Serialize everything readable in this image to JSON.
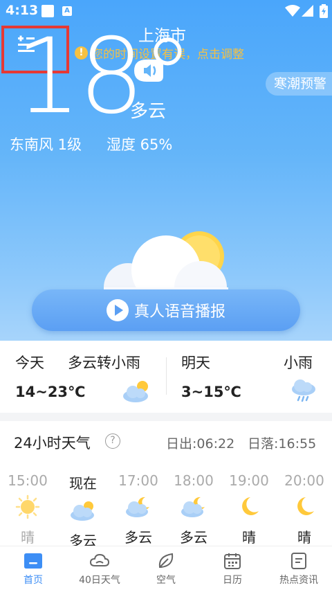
{
  "status_bar": {
    "time": "4:13",
    "app_badge": "A"
  },
  "header": {
    "city": "上海市",
    "warning": "您的时间设置有误，点击调整"
  },
  "current": {
    "temperature": "18°",
    "condition": "多云",
    "wind": "东南风 1级",
    "humidity": "湿度 65%",
    "alert": "寒潮预警"
  },
  "voice": {
    "label": "真人语音播报"
  },
  "forecast": [
    {
      "day": "今天",
      "condition": "多云转小雨",
      "range": "14~23℃",
      "icon": "cloudy-sun-icon"
    },
    {
      "day": "明天",
      "condition": "小雨",
      "range": "3~15℃",
      "icon": "light-rain-icon"
    }
  ],
  "hourly": {
    "title": "24小时天气",
    "sunrise": "日出:06:22",
    "sunset": "日落:16:55",
    "items": [
      {
        "time": "15:00",
        "icon": "sun-icon",
        "condition": "晴",
        "past": true
      },
      {
        "time": "现在",
        "icon": "cloudy-sun-icon",
        "condition": "多云",
        "past": false
      },
      {
        "time": "17:00",
        "icon": "cloudy-moon-icon",
        "condition": "多云",
        "past": false
      },
      {
        "time": "18:00",
        "icon": "cloudy-moon-icon",
        "condition": "多云",
        "past": false
      },
      {
        "time": "19:00",
        "icon": "moon-icon",
        "condition": "晴",
        "past": false
      },
      {
        "time": "20:00",
        "icon": "moon-icon",
        "condition": "晴",
        "past": false
      }
    ]
  },
  "nav": [
    {
      "label": "首页",
      "icon": "home-icon",
      "active": true
    },
    {
      "label": "40日天气",
      "icon": "cloud-icon",
      "active": false
    },
    {
      "label": "空气",
      "icon": "leaf-icon",
      "active": false
    },
    {
      "label": "日历",
      "icon": "calendar-icon",
      "active": false
    },
    {
      "label": "热点资讯",
      "icon": "news-icon",
      "active": false
    }
  ],
  "colors": {
    "accent": "#3d8ef5",
    "warning": "#f6c142",
    "highlight": "#e53935"
  }
}
